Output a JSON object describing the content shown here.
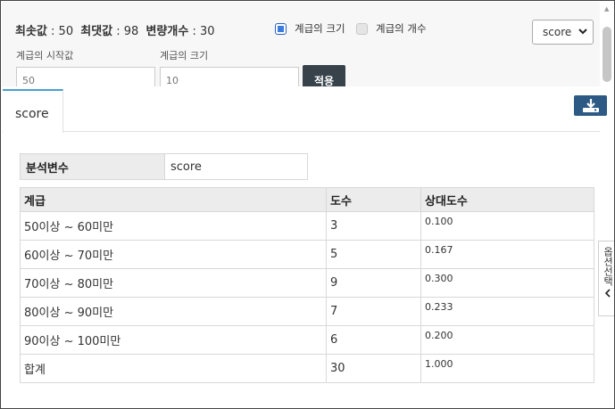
{
  "stats": {
    "min_label": "최솟값",
    "min_value": ": 50",
    "max_label": "최댓값",
    "max_value": ": 98",
    "count_label": "변량개수",
    "count_value": ": 30"
  },
  "options": {
    "class_width_label": "계급의 크기",
    "class_width_checked": true,
    "class_count_label": "계급의 개수",
    "class_count_checked": false,
    "variable_select": "score"
  },
  "fields": {
    "start_label": "계급의 시작값",
    "start_value": "50",
    "width_label": "계급의 크기",
    "width_value": "10",
    "apply_label": "적용"
  },
  "tab": {
    "label": "score"
  },
  "icons": {
    "download": "download-icon",
    "option": "chevron-left-icon"
  },
  "colors": {
    "accent": "#4a9fd0",
    "button_dark": "#37424b",
    "download_bg": "#2c5a84"
  },
  "variable_table": {
    "header": "분석변수",
    "value": "score"
  },
  "freq_table": {
    "headers": [
      "계급",
      "도수",
      "상대도수"
    ],
    "rows": [
      [
        "50이상 ~ 60미만",
        "3",
        "0.100"
      ],
      [
        "60이상 ~ 70미만",
        "5",
        "0.167"
      ],
      [
        "70이상 ~ 80미만",
        "9",
        "0.300"
      ],
      [
        "80이상 ~ 90미만",
        "7",
        "0.233"
      ],
      [
        "90이상 ~ 100미만",
        "6",
        "0.200"
      ],
      [
        "합계",
        "30",
        "1.000"
      ]
    ]
  },
  "side_tab": {
    "label": "옵션선택"
  }
}
